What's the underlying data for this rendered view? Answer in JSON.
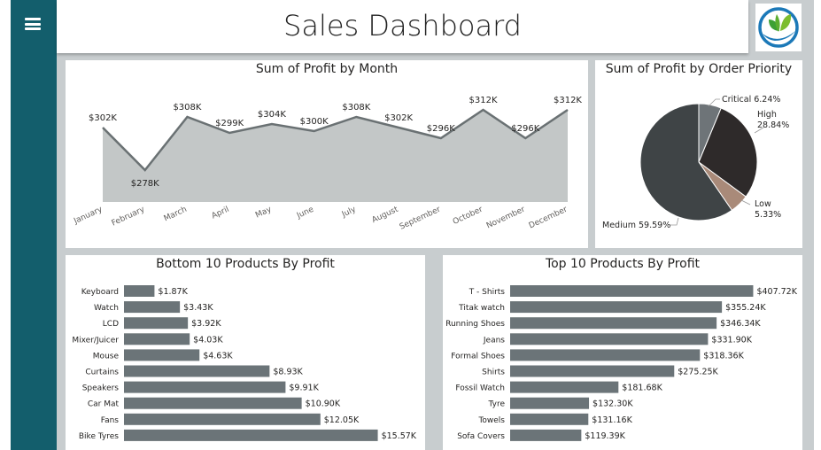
{
  "header": {
    "title": "Sales Dashboard",
    "menu_icon": "hamburger-menu-icon",
    "logo_icon": "leaf-globe-logo"
  },
  "colors": {
    "sidebar": "#135e6c",
    "area_fill": "#c3c7c7",
    "area_line": "#6a7173",
    "bar": "#6b7478",
    "pie_medium": "#3f4446",
    "pie_high": "#2e2a2a",
    "pie_low": "#a98a79",
    "pie_critical": "#6e7478"
  },
  "charts": [
    {
      "id": "profit-by-month",
      "title": "Sum of Profit by Month",
      "chart_data": {
        "type": "area",
        "title": "Sum of Profit by Month",
        "categories": [
          "January",
          "February",
          "March",
          "April",
          "May",
          "June",
          "July",
          "August",
          "September",
          "October",
          "November",
          "December"
        ],
        "values": [
          302,
          278,
          308,
          299,
          304,
          300,
          308,
          302,
          296,
          312,
          296,
          312
        ],
        "labels": [
          "$302K",
          "$278K",
          "$308K",
          "$299K",
          "$304K",
          "$300K",
          "$308K",
          "$302K",
          "$296K",
          "$312K",
          "$296K",
          "$312K"
        ],
        "ylim": [
          270,
          316
        ],
        "grid": false
      }
    },
    {
      "id": "profit-by-priority",
      "title": "Sum of Profit by Order Priority",
      "chart_data": {
        "type": "pie",
        "title": "Sum of Profit by Order Priority",
        "slices": [
          {
            "name": "Critical",
            "value": 6.24,
            "label": "6.24%"
          },
          {
            "name": "High",
            "value": 28.84,
            "label": "28.84%"
          },
          {
            "name": "Low",
            "value": 5.33,
            "label": "5.33%"
          },
          {
            "name": "Medium",
            "value": 59.59,
            "label": "59.59%"
          }
        ]
      }
    },
    {
      "id": "bottom-10-products",
      "title": "Bottom 10 Products By Profit",
      "chart_data": {
        "type": "bar",
        "orientation": "horizontal",
        "title": "Bottom 10 Products By Profit",
        "categories": [
          "Keyboard",
          "Watch",
          "LCD",
          "Mixer/Juicer",
          "Mouse",
          "Curtains",
          "Speakers",
          "Car Mat",
          "Fans",
          "Bike Tyres"
        ],
        "values": [
          1.87,
          3.43,
          3.92,
          4.03,
          4.63,
          8.93,
          9.91,
          10.9,
          12.05,
          15.57
        ],
        "labels": [
          "$1.87K",
          "$3.43K",
          "$3.92K",
          "$4.03K",
          "$4.63K",
          "$8.93K",
          "$9.91K",
          "$10.90K",
          "$12.05K",
          "$15.57K"
        ],
        "xlim": [
          0,
          16.3
        ]
      }
    },
    {
      "id": "top-10-products",
      "title": "Top 10 Products By Profit",
      "chart_data": {
        "type": "bar",
        "orientation": "horizontal",
        "title": "Top 10 Products By Profit",
        "categories": [
          "T - Shirts",
          "Titak watch",
          "Running Shoes",
          "Jeans",
          "Formal Shoes",
          "Shirts",
          "Fossil Watch",
          "Tyre",
          "Towels",
          "Sofa Covers"
        ],
        "values": [
          407.72,
          355.24,
          346.34,
          331.9,
          318.36,
          275.25,
          181.68,
          132.3,
          131.16,
          119.39
        ],
        "labels": [
          "$407.72K",
          "$355.24K",
          "$346.34K",
          "$331.90K",
          "$318.36K",
          "$275.25K",
          "$181.68K",
          "$132.30K",
          "$131.16K",
          "$119.39K"
        ],
        "xlim": [
          0,
          413
        ]
      }
    }
  ]
}
